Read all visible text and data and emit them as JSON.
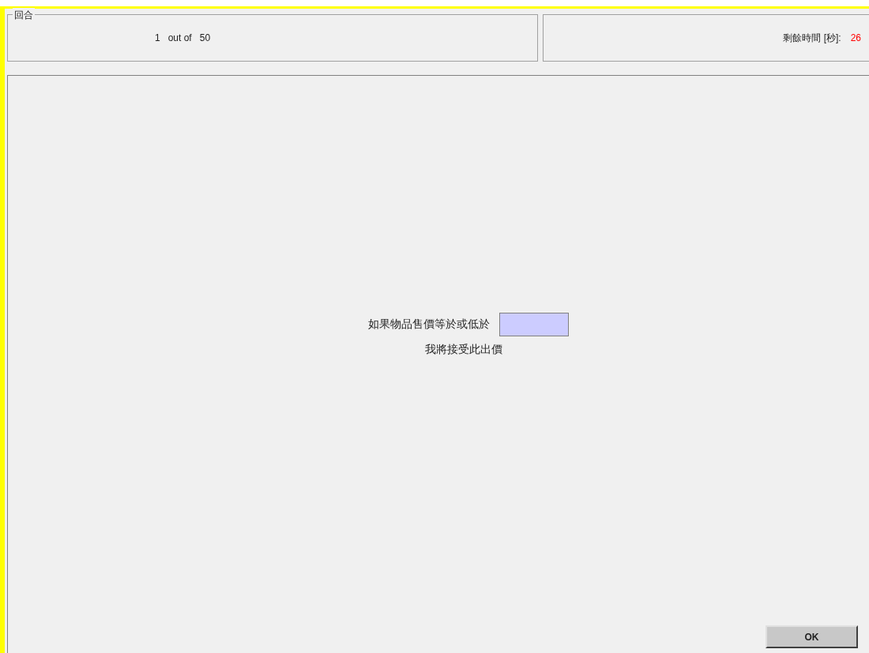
{
  "round_panel": {
    "legend": "回合",
    "current": "1",
    "separator": "out of",
    "total": "50"
  },
  "timer_panel": {
    "label": "剩餘時間 [秒]:",
    "value": "26"
  },
  "bid": {
    "prompt": "如果物品售價等於或低於",
    "caption": "我將接受此出價"
  },
  "ok_button": {
    "label": "OK"
  }
}
